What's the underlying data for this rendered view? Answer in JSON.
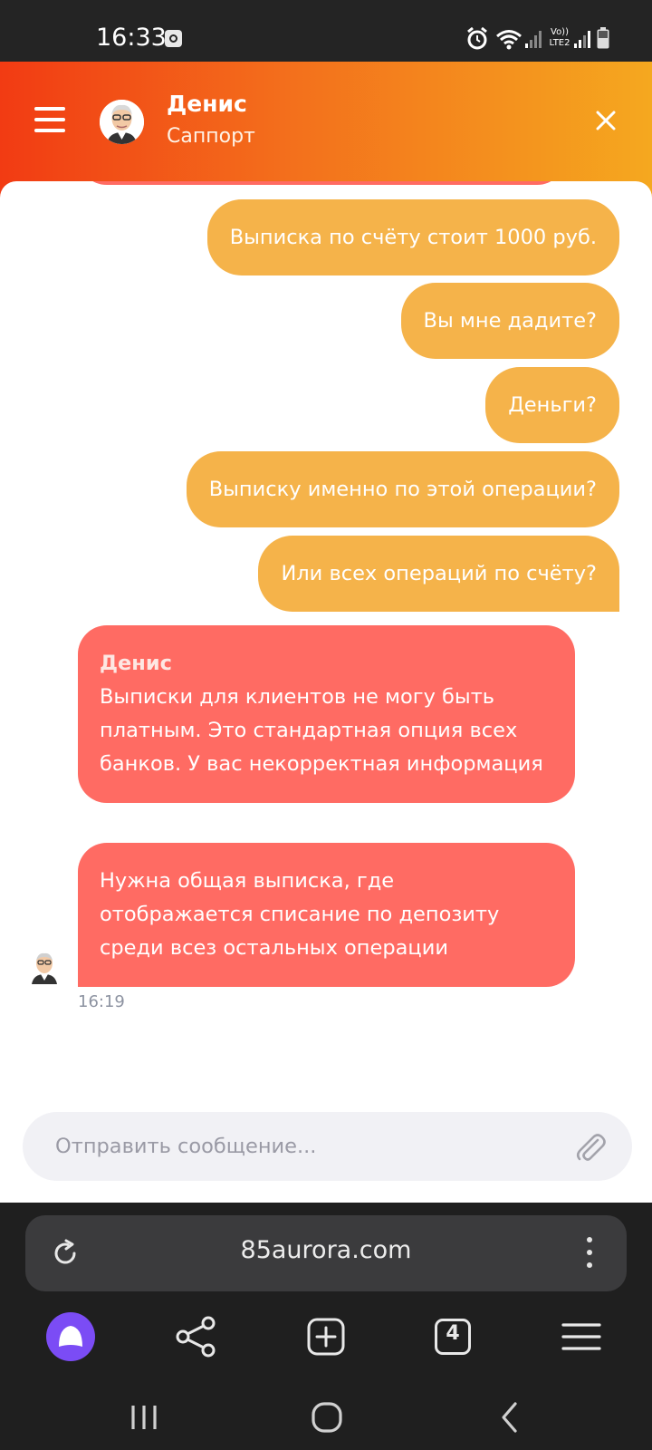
{
  "status_bar": {
    "time": "16:33",
    "network_label": "Vo)) LTE2"
  },
  "header": {
    "name": "Денис",
    "role": "Саппорт"
  },
  "messages_out": [
    "Выписка по счёту стоит 1000 руб.",
    "Вы мне дадите?",
    "Деньги?",
    "Выписку именно по этой операции?",
    "Или всех операций по счёту?"
  ],
  "messages_in": [
    {
      "sender": "Денис",
      "text": "Выписки для клиентов не могу быть платным. Это стандартная опция всех банков. У вас некорректная информация"
    },
    {
      "text": "Нужна общая выписка, где отображается списание по депозиту среди всез остальных операции"
    }
  ],
  "last_time": "16:19",
  "input": {
    "placeholder": "Отправить сообщение..."
  },
  "browser": {
    "url": "85aurora.com",
    "tabs_count": "4"
  },
  "colors": {
    "outgoing_bubble": "#f5b34a",
    "incoming_bubble": "#ff6b63",
    "header_gradient_start": "#f23b13",
    "header_gradient_end": "#f5a81f",
    "alice_button": "#7b4cf5"
  }
}
